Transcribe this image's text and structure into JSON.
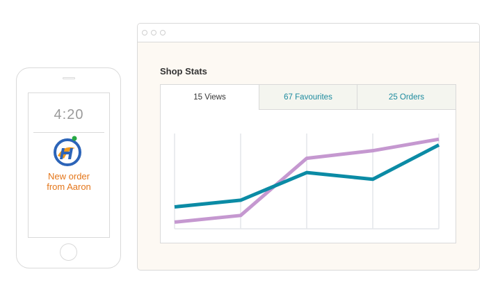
{
  "phone": {
    "time": "4:20",
    "notification": {
      "line1": "New order",
      "line2": "from Aaron"
    },
    "logo_colors": {
      "ring": "#2c64b8",
      "accent": "#f39a1b",
      "dot": "#27a844"
    }
  },
  "window": {
    "title": "Shop Stats",
    "tabs": [
      {
        "label": "15 Views",
        "active": true
      },
      {
        "label": "67 Favourites",
        "active": false
      },
      {
        "label": "25 Orders",
        "active": false
      }
    ]
  },
  "colors": {
    "views_line": "#c598d0",
    "orders_line": "#0b8ba5",
    "tab_text": "#1b8a9e",
    "notification": "#e4761a"
  },
  "chart_data": {
    "type": "line",
    "title": "",
    "xlabel": "",
    "ylabel": "",
    "x": [
      1,
      2,
      3,
      4,
      5
    ],
    "ylim": [
      0,
      100
    ],
    "grid": true,
    "series": [
      {
        "values": [
          7,
          14,
          74,
          82,
          94
        ],
        "color": "#c598d0"
      },
      {
        "values": [
          23,
          30,
          59,
          52,
          88
        ],
        "color": "#0b8ba5"
      }
    ]
  }
}
